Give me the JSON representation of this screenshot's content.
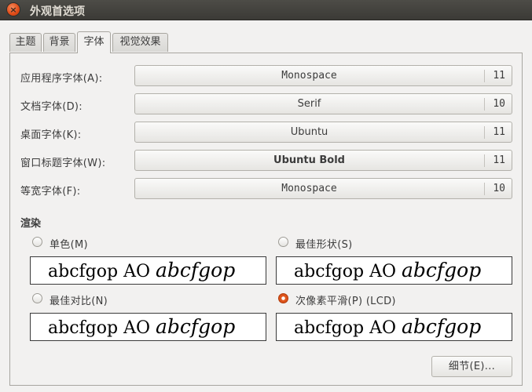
{
  "window": {
    "title": "外观首选项",
    "close_glyph": "×"
  },
  "tabs": [
    {
      "label": "主题",
      "active": false
    },
    {
      "label": "背景",
      "active": false
    },
    {
      "label": "字体",
      "active": true
    },
    {
      "label": "视觉效果",
      "active": false
    }
  ],
  "fonts": [
    {
      "label": "应用程序字体(A):",
      "font": "Monospace",
      "size": "11"
    },
    {
      "label": "文档字体(D):",
      "font": "Serif",
      "size": "10"
    },
    {
      "label": "桌面字体(K):",
      "font": "Ubuntu",
      "size": "11"
    },
    {
      "label": "窗口标题字体(W):",
      "font": "Ubuntu Bold",
      "size": "11"
    },
    {
      "label": "等宽字体(F):",
      "font": "Monospace",
      "size": "10"
    }
  ],
  "rendering": {
    "title": "渲染",
    "options": [
      {
        "label": "单色(M)",
        "checked": false
      },
      {
        "label": "最佳形状(S)",
        "checked": false
      },
      {
        "label": "最佳对比(N)",
        "checked": false
      },
      {
        "label": "次像素平滑(P) (LCD)",
        "checked": true
      }
    ],
    "preview_regular": "abcfgop AO ",
    "preview_italic": "abcfgop"
  },
  "details_button": "细节(E)...",
  "colors": {
    "titlebar": "#3c3b37",
    "radio_checked": "#e35b22",
    "background": "#f2f1f0"
  }
}
